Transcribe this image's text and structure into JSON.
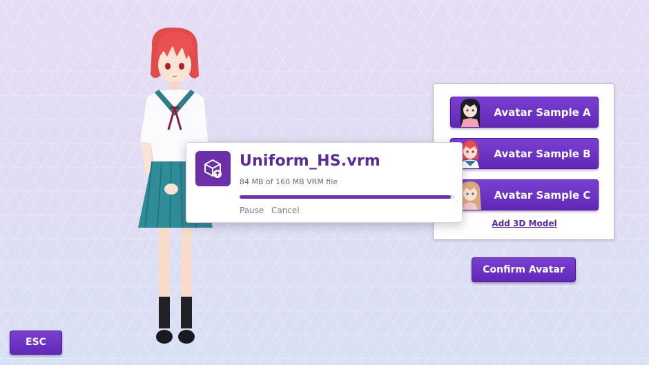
{
  "avatar_panel": {
    "samples": [
      {
        "label": "Avatar Sample A",
        "thumb": "avatar-a-thumb"
      },
      {
        "label": "Avatar Sample B",
        "thumb": "avatar-b-thumb"
      },
      {
        "label": "Avatar Sample C",
        "thumb": "avatar-c-thumb"
      }
    ],
    "add_model_label": "Add 3D Model"
  },
  "confirm_label": "Confirm Avatar",
  "esc_label": "ESC",
  "upload": {
    "icon": "package-upload-icon",
    "file_name": "Uniform_HS.vrm",
    "progress_text": "84 MB of 160 MB VRM file",
    "progress_fraction": 0.98,
    "pause_label": "Pause",
    "cancel_label": "Cancel"
  },
  "colors": {
    "accent": "#6b2fa8",
    "button": "#6a30c2"
  }
}
